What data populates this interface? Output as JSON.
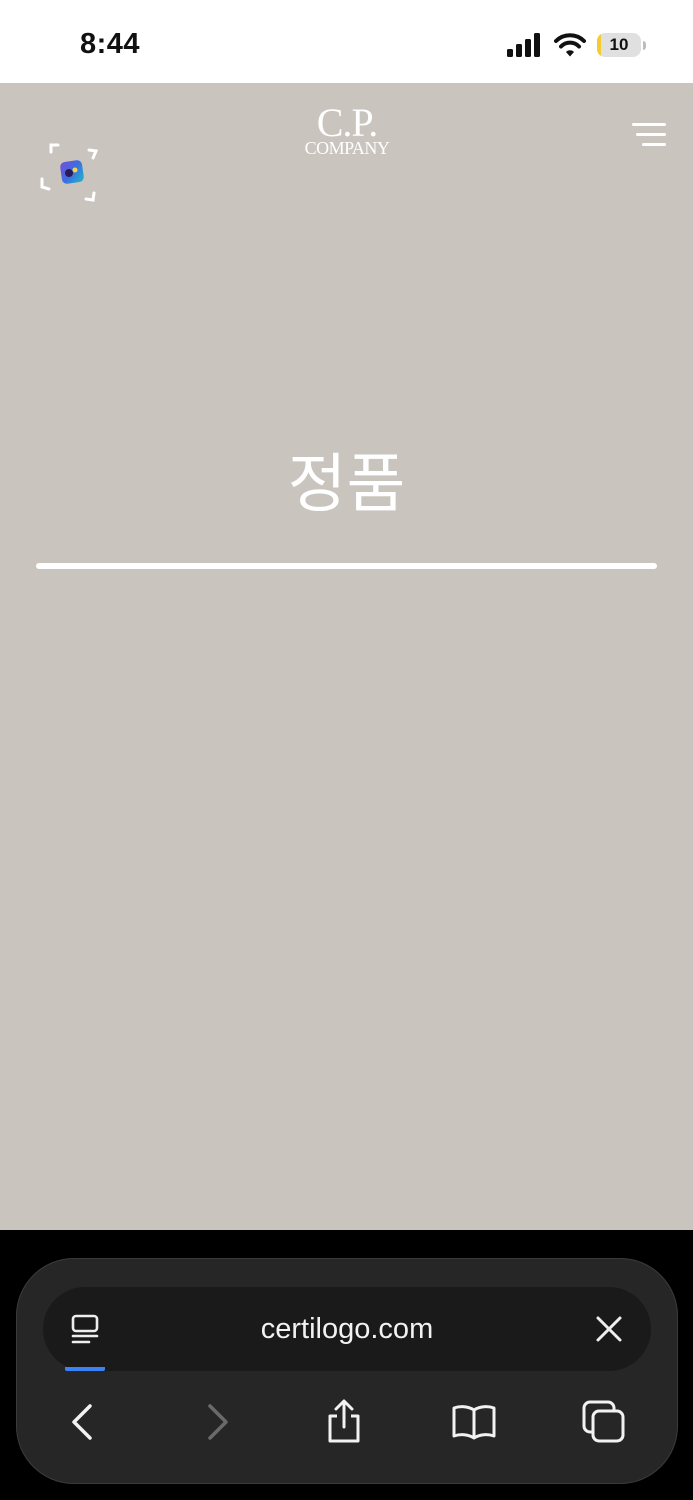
{
  "status_bar": {
    "time": "8:44",
    "battery_level": "10",
    "battery_fill_percent": 10,
    "icons": [
      "signal-icon",
      "wifi-icon",
      "battery-icon"
    ]
  },
  "header": {
    "logo_monogram": "C.P.",
    "logo_wordmark": "COMPANY",
    "icons": [
      "scan-icon",
      "menu-icon"
    ]
  },
  "content": {
    "heading": "정품"
  },
  "browser": {
    "url": "certilogo.com",
    "icons": [
      "page-menu-icon",
      "close-icon",
      "back-icon",
      "forward-icon",
      "share-icon",
      "bookmarks-icon",
      "tabs-icon"
    ]
  },
  "colors": {
    "page_background": "#c9c5be",
    "status_bar_background": "#ffffff",
    "browser_background": "#262626",
    "accent_progress": "#3b82f6",
    "battery_yellow": "#f3cc2e"
  }
}
